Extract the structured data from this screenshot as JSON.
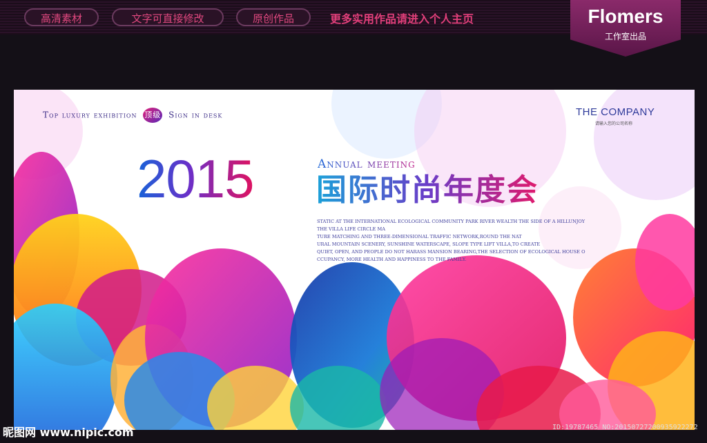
{
  "topbar": {
    "tabs": [
      "高清素材",
      "文字可直接修改",
      "原创作品"
    ],
    "promo": "更多实用作品请进入个人主页",
    "brand": {
      "name": "Flomers",
      "sub": "工作室出品"
    }
  },
  "poster": {
    "tagline_left": "Top luxury exhibition",
    "badge": "顶级",
    "tagline_right": "Sign in desk",
    "company": "THE COMPANY",
    "company_sub": "请输入您的公司名称",
    "year": "2015",
    "annual": "Annual meeting",
    "title_cn": "国际时尚年度会",
    "description": [
      "STATIC AT THE INTERNATIONAL ECOLOGICAL COMMUNITY PARK RIVER WEALTH THE SIDE OF A HILLUNJOY",
      "THE VILLA LIFE CIRCLE MA",
      "TURE MATCHING AND THREE-DIMENSIONAL TRAFFIC NETWORK,ROUND THE NAT",
      "URAL MOUNTAIN SCENERY, SUNSHINE WATERSCAPE, SLOPE TYPE LIFT VILLA,TO CREATE",
      "QUIET, OPEN, AND PEOPLE DO NOT HARASS MANSION BEARING,THE SELECTION OF ECOLOGICAL HOUSE O",
      "CCUPANCY, MORE HEALTH AND HAPPINESS TO THE FAMILY."
    ]
  },
  "footer": {
    "left": "昵图网 www.nipic.com",
    "right": "ID:19787465 NO:20150727200935922272"
  },
  "colors": {
    "background": "#141017",
    "accent": "#e0487f",
    "brand_box": "#7a2060"
  }
}
